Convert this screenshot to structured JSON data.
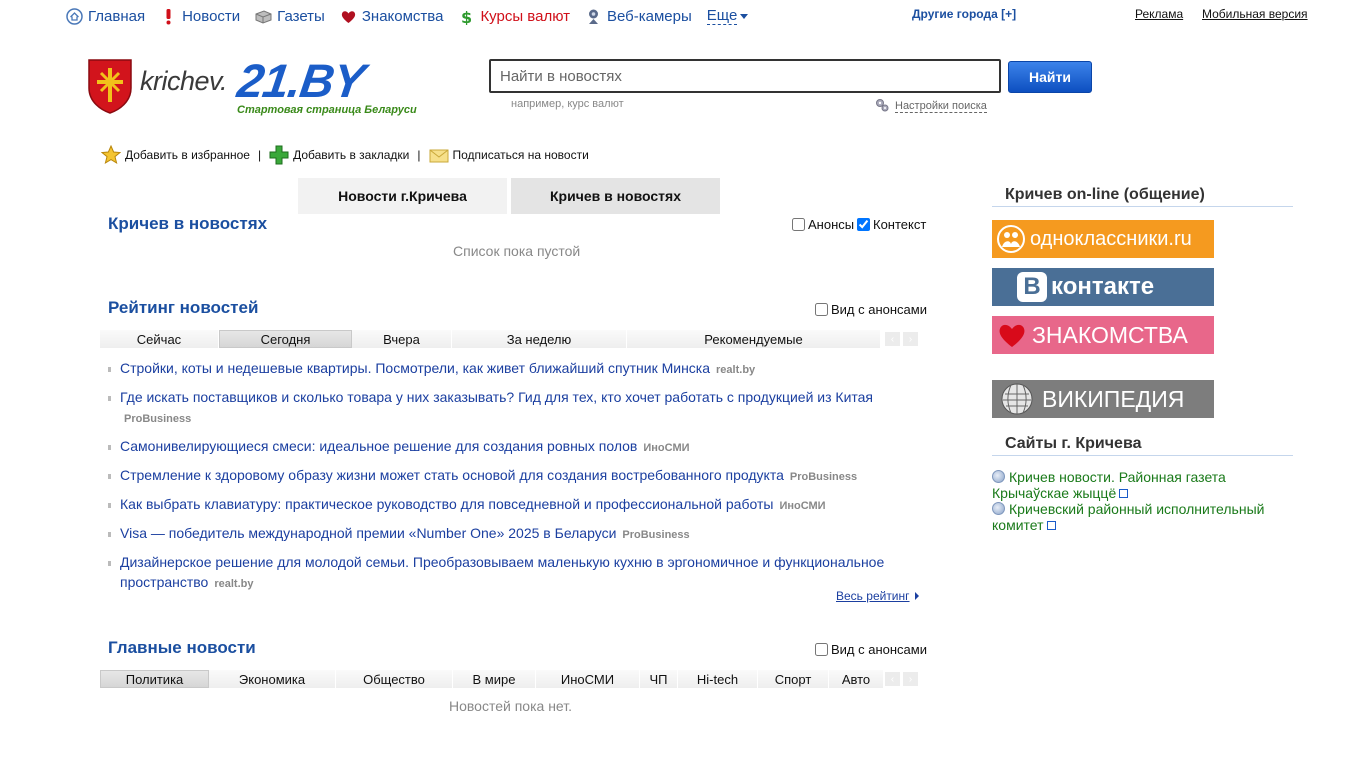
{
  "topnav": {
    "items": [
      {
        "label": "Главная",
        "icon": "home-icon"
      },
      {
        "label": "Новости",
        "icon": "exclamation-icon"
      },
      {
        "label": "Газеты",
        "icon": "newspaper-icon"
      },
      {
        "label": "Знакомства",
        "icon": "heart-icon"
      },
      {
        "label": "Курсы валют",
        "icon": "dollar-icon"
      },
      {
        "label": "Веб-камеры",
        "icon": "webcam-icon"
      }
    ],
    "more": "Еще",
    "other_cities": "Другие города [+]",
    "ads": "Реклама",
    "mobile": "Мобильная версия"
  },
  "logo": {
    "city": "krichev.",
    "brand": "21.BY",
    "tagline": "Стартовая страница Беларуси"
  },
  "search": {
    "placeholder": "Найти в новостях",
    "button": "Найти",
    "hint": "например, курс валют",
    "settings": "Настройки поиска"
  },
  "actions": {
    "favorites": "Добавить в избранное",
    "bookmarks": "Добавить в закладки",
    "subscribe": "Подписаться на новости"
  },
  "tabs": {
    "news_city": "Новости г.Кричева",
    "city_in_news": "Кричев в новостях"
  },
  "section_city": {
    "title": "Кричев в новостях",
    "opt_announce": "Анонсы",
    "opt_context": "Контекст",
    "empty": "Список пока пустой"
  },
  "rating": {
    "title": "Рейтинг новостей",
    "opt_announce": "Вид с анонсами",
    "tabs": [
      "Сейчас",
      "Сегодня",
      "Вчера",
      "За неделю",
      "Рекомендуемые"
    ],
    "items": [
      {
        "title": "Стройки, коты и недешевые квартиры. Посмотрели, как живет ближайший спутник Минска",
        "source": "realt.by"
      },
      {
        "title": "Где искать поставщиков и сколько товара у них заказывать? Гид для тех, кто хочет работать с продукцией из Китая",
        "source": "ProBusiness"
      },
      {
        "title": "Самонивелирующиеся смеси: идеальное решение для создания ровных полов",
        "source": "ИноСМИ"
      },
      {
        "title": "Стремление к здоровому образу жизни может стать основой для создания востребованного продукта",
        "source": "ProBusiness"
      },
      {
        "title": "Как выбрать клавиатуру: практическое руководство для повседневной и профессиональной работы",
        "source": "ИноСМИ"
      },
      {
        "title": "Visa — победитель международной премии «Number One» 2025 в Беларуси",
        "source": "ProBusiness"
      },
      {
        "title": "Дизайнерское решение для молодой семьи. Преобразовываем маленькую кухню в эргономичное и функциональное пространство",
        "source": "realt.by"
      }
    ],
    "all": "Весь рейтинг"
  },
  "main_news": {
    "title": "Главные новости",
    "opt_announce": "Вид с анонсами",
    "tabs": [
      "Политика",
      "Экономика",
      "Общество",
      "В мире",
      "ИноСМИ",
      "ЧП",
      "Hi-tech",
      "Спорт",
      "Авто"
    ],
    "empty": "Новостей пока нет."
  },
  "right": {
    "online_title": "Кричев on-line (общение)",
    "banners": {
      "ok": "одноклассники.ru",
      "vk": "контакте",
      "dating": "ЗНАКОМСТВА",
      "wiki": "ВИКИПЕДИЯ"
    },
    "sites_title": "Сайты г. Кричева",
    "sites": [
      "Кричев новости. Районная газета Крычаўскае жыццё",
      "Кричевский районный исполнительный комитет"
    ]
  },
  "colors": {
    "link_blue": "#1b4fa0",
    "brand_blue": "#1b5dc8",
    "ok_orange": "#f59a1f",
    "vk_blue": "#4a6f96",
    "dating_pink": "#e8678a",
    "wiki_gray": "#7d7d7d"
  }
}
